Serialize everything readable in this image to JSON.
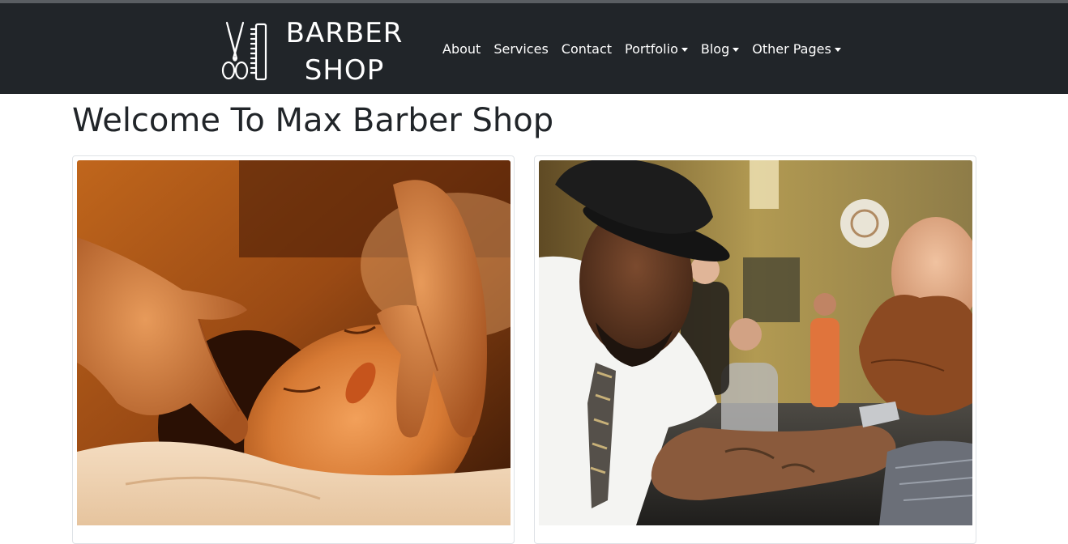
{
  "brand": {
    "line1": "BARBER",
    "line2": "SHOP"
  },
  "nav": {
    "items": [
      {
        "label": "About",
        "dropdown": false
      },
      {
        "label": "Services",
        "dropdown": false
      },
      {
        "label": "Contact",
        "dropdown": false
      },
      {
        "label": "Portfolio",
        "dropdown": true
      },
      {
        "label": "Blog",
        "dropdown": true
      },
      {
        "label": "Other Pages",
        "dropdown": true
      }
    ]
  },
  "main": {
    "title": "Welcome To Max Barber Shop"
  },
  "cards": [
    {
      "image": "facial-massage-photo"
    },
    {
      "image": "barber-shaving-photo"
    }
  ],
  "colors": {
    "navbar_bg": "#212529",
    "nav_text": "#ffffff",
    "title_text": "#212529",
    "card_border": "#dee2e6"
  }
}
